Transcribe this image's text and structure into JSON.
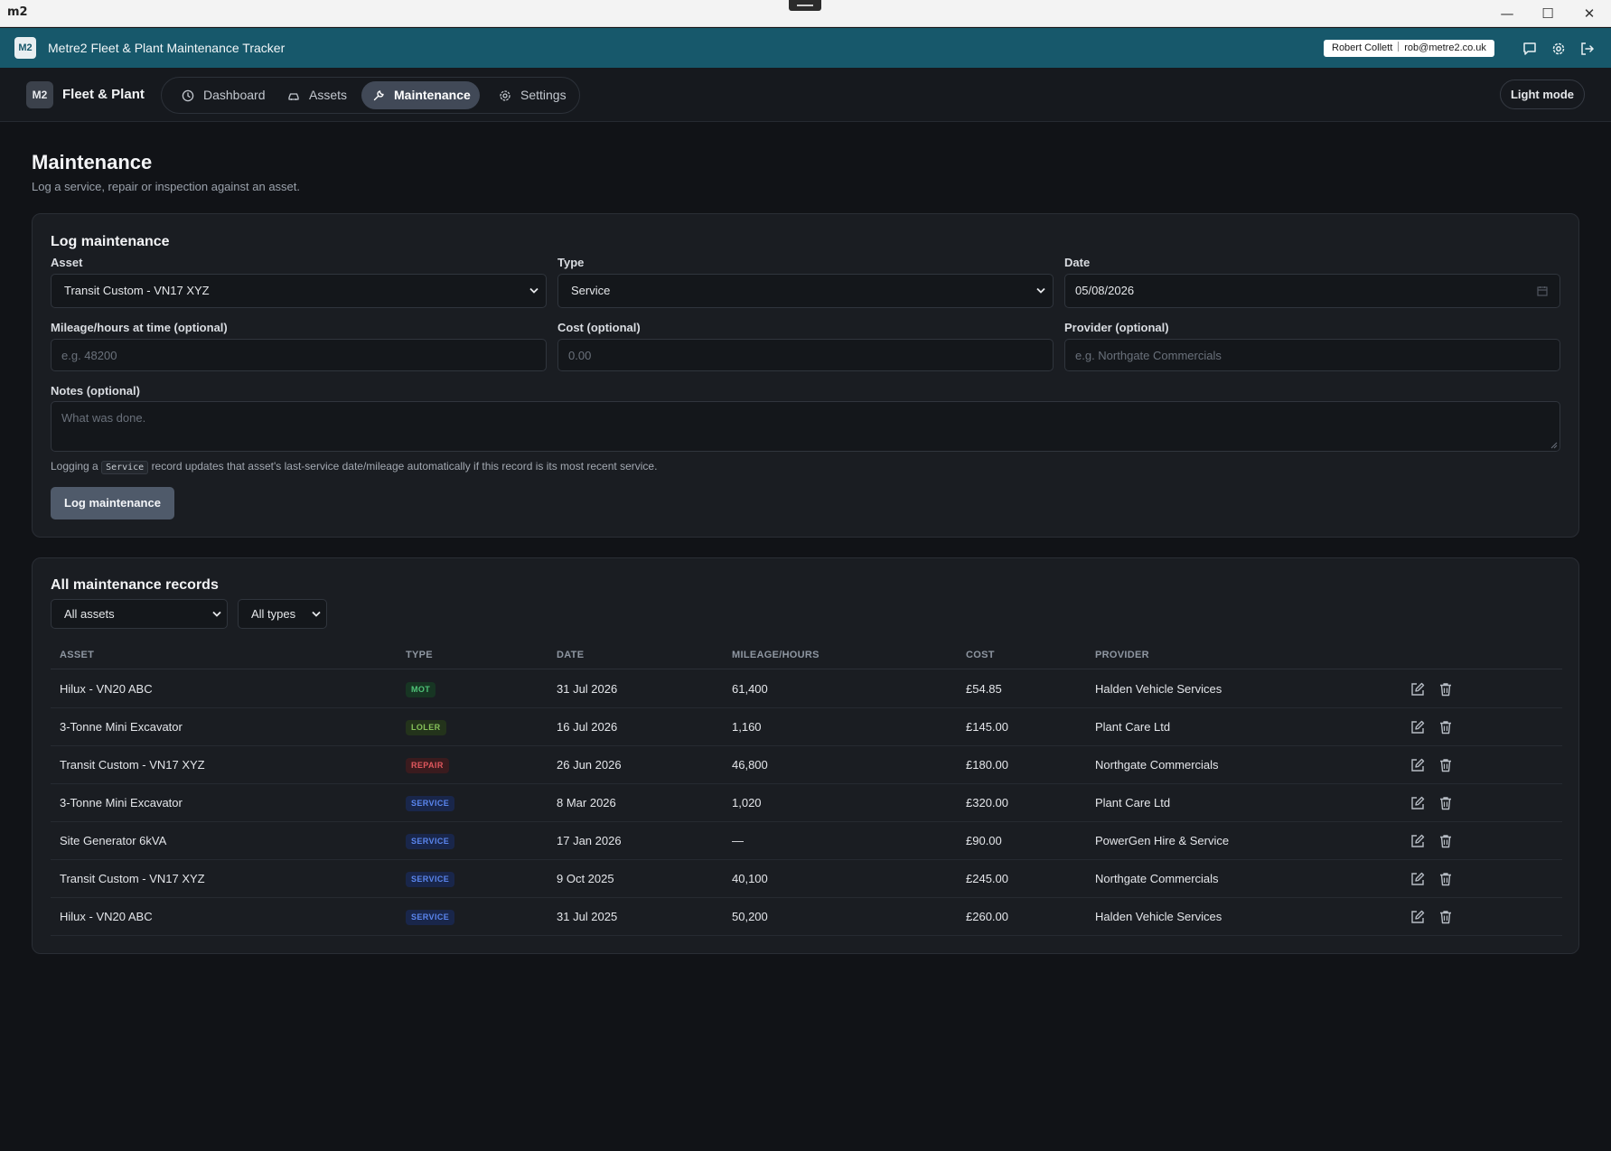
{
  "window": {
    "logo": "m2",
    "controls": {
      "minimize": "—",
      "maximize": "☐",
      "close": "✕"
    }
  },
  "app_bar": {
    "badge": "M2",
    "title": "Metre2 Fleet & Plant Maintenance Tracker",
    "user_name": "Robert Collett",
    "user_email": "rob@metre2.co.uk",
    "icons": [
      "chat-icon",
      "gear-icon",
      "logout-icon"
    ]
  },
  "nav": {
    "brand_badge": "M2",
    "brand_name": "Fleet & Plant",
    "tabs": [
      {
        "label": "Dashboard",
        "icon": "clock-icon",
        "active": false
      },
      {
        "label": "Assets",
        "icon": "car-icon",
        "active": false
      },
      {
        "label": "Maintenance",
        "icon": "wrench-icon",
        "active": true
      },
      {
        "label": "Settings",
        "icon": "gear-icon",
        "active": false
      }
    ],
    "theme_button": "Light mode"
  },
  "page": {
    "title": "Maintenance",
    "subtitle": "Log a service, repair or inspection against an asset."
  },
  "form": {
    "title": "Log maintenance",
    "asset": {
      "label": "Asset",
      "value": "Transit Custom - VN17 XYZ"
    },
    "type": {
      "label": "Type",
      "value": "Service"
    },
    "date": {
      "label": "Date",
      "value": "05/08/2026"
    },
    "mileage": {
      "label": "Mileage/hours at time (optional)",
      "placeholder": "e.g. 48200"
    },
    "cost": {
      "label": "Cost (optional)",
      "placeholder": "0.00"
    },
    "provider": {
      "label": "Provider (optional)",
      "placeholder": "e.g. Northgate Commercials"
    },
    "notes": {
      "label": "Notes (optional)",
      "placeholder": "What was done."
    },
    "hint_before": "Logging a",
    "hint_code": "Service",
    "hint_after": "record updates that asset's last-service date/mileage automatically if this record is its most recent service.",
    "submit": "Log maintenance"
  },
  "records": {
    "title": "All maintenance records",
    "filter_assets": "All assets",
    "filter_types": "All types",
    "columns": [
      "ASSET",
      "TYPE",
      "DATE",
      "MILEAGE/HOURS",
      "COST",
      "PROVIDER"
    ],
    "rows": [
      {
        "asset": "Hilux - VN20 ABC",
        "type": "MOT",
        "type_class": "mot",
        "date": "31 Jul 2026",
        "mileage": "61,400",
        "cost": "£54.85",
        "provider": "Halden Vehicle Services"
      },
      {
        "asset": "3-Tonne Mini Excavator",
        "type": "LOLER",
        "type_class": "loler",
        "date": "16 Jul 2026",
        "mileage": "1,160",
        "cost": "£145.00",
        "provider": "Plant Care Ltd"
      },
      {
        "asset": "Transit Custom - VN17 XYZ",
        "type": "REPAIR",
        "type_class": "repair",
        "date": "26 Jun 2026",
        "mileage": "46,800",
        "cost": "£180.00",
        "provider": "Northgate Commercials"
      },
      {
        "asset": "3-Tonne Mini Excavator",
        "type": "SERVICE",
        "type_class": "service",
        "date": "8 Mar 2026",
        "mileage": "1,020",
        "cost": "£320.00",
        "provider": "Plant Care Ltd"
      },
      {
        "asset": "Site Generator 6kVA",
        "type": "SERVICE",
        "type_class": "service",
        "date": "17 Jan 2026",
        "mileage": "—",
        "cost": "£90.00",
        "provider": "PowerGen Hire & Service"
      },
      {
        "asset": "Transit Custom - VN17 XYZ",
        "type": "SERVICE",
        "type_class": "service",
        "date": "9 Oct 2025",
        "mileage": "40,100",
        "cost": "£245.00",
        "provider": "Northgate Commercials"
      },
      {
        "asset": "Hilux - VN20 ABC",
        "type": "SERVICE",
        "type_class": "service",
        "date": "31 Jul 2025",
        "mileage": "50,200",
        "cost": "£260.00",
        "provider": "Halden Vehicle Services"
      }
    ]
  },
  "colors": {
    "app_bar": "#17586b",
    "background": "#111317",
    "card": "#1a1d22",
    "active_tab": "#414957",
    "primary_button": "#4f5a6a"
  }
}
